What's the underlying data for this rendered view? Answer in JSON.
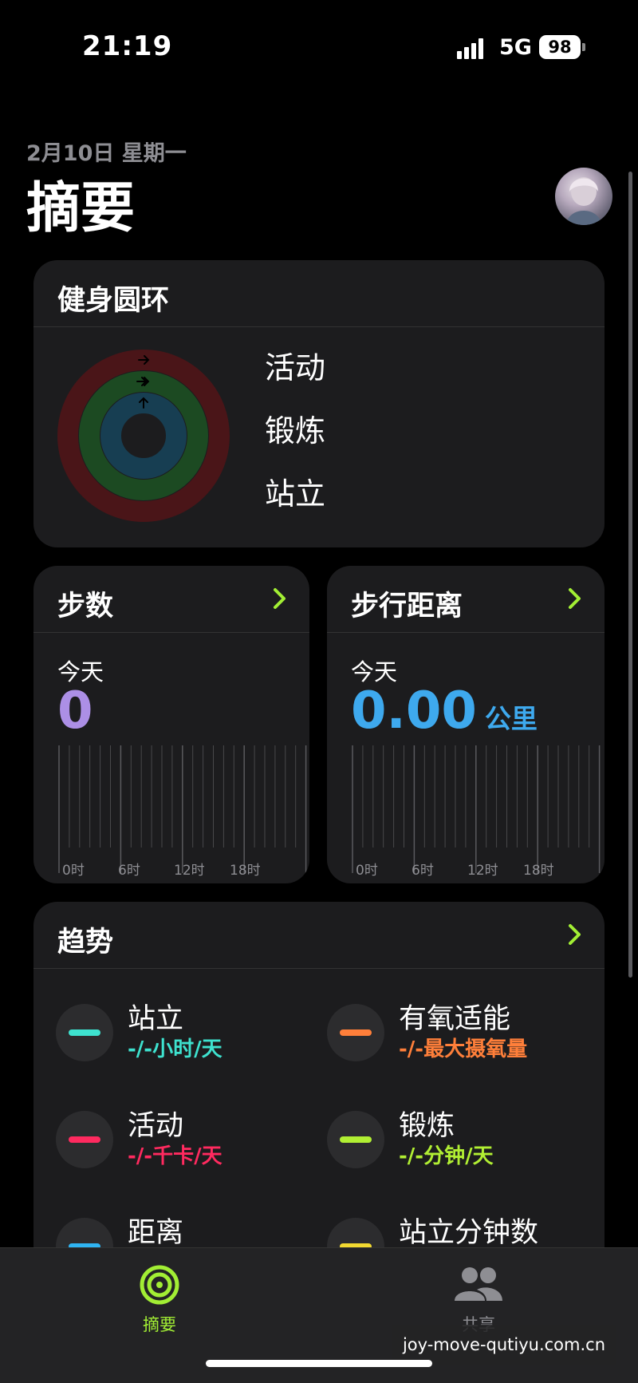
{
  "status_bar": {
    "time": "21:19",
    "network": "5G",
    "battery": "98"
  },
  "header": {
    "date": "2月10日 星期一",
    "title": "摘要"
  },
  "rings_card": {
    "title": "健身圆环",
    "labels": [
      "活动",
      "锻炼",
      "站立"
    ],
    "colors": {
      "move": "#4a1518",
      "exercise": "#1c4a22",
      "stand": "#173e52"
    }
  },
  "steps_card": {
    "title": "步数",
    "today": "今天",
    "value": "0",
    "color": "#ac8fe6"
  },
  "distance_card": {
    "title": "步行距离",
    "today": "今天",
    "value": "0.00",
    "unit": "公里",
    "color": "#3ea9ee"
  },
  "hour_ticks": [
    "0时",
    "6时",
    "12时",
    "18时"
  ],
  "trends_card": {
    "title": "趋势",
    "items": [
      {
        "name": "站立",
        "value": "-/-小时/天",
        "color": "#3ee2cf"
      },
      {
        "name": "有氧适能",
        "value": "-/-最大摄氧量",
        "color": "#ff7f3a"
      },
      {
        "name": "活动",
        "value": "-/-千卡/天",
        "color": "#ff2a5f"
      },
      {
        "name": "锻炼",
        "value": "-/-分钟/天",
        "color": "#b1ef33"
      },
      {
        "name": "距离",
        "value": "",
        "color": "#2fb4f2"
      },
      {
        "name": "站立分钟数",
        "value": "",
        "color": "#f2d931"
      }
    ]
  },
  "tab_bar": {
    "summary_label": "摘要",
    "sharing_label": "共享"
  },
  "accent_color": "#a2ee34",
  "watermark": "joy-move-qutiyu.com.cn"
}
